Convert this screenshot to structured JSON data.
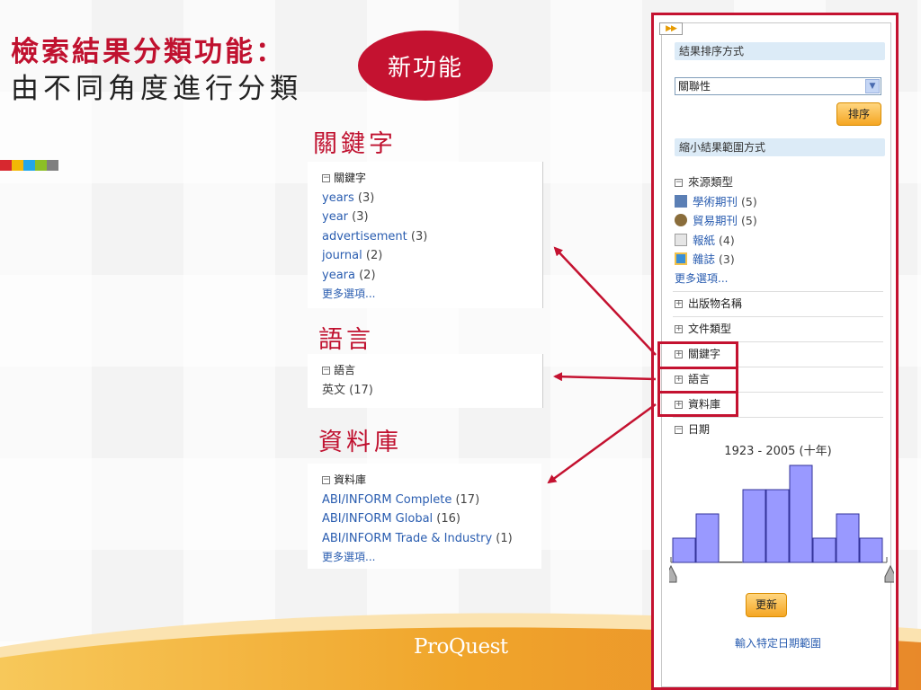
{
  "slide": {
    "title_line1": "檢索結果分類功能：",
    "title_line2": "由不同角度進行分類",
    "badge": "新功能",
    "strip_colors": [
      "#d7282f",
      "#f2b705",
      "#22a6e8",
      "#8cbf26",
      "#7f7f7f"
    ],
    "accent": "#c41230"
  },
  "sections": {
    "keyword": {
      "heading": "關鍵字",
      "facet_label": "關鍵字",
      "items": [
        {
          "term": "years",
          "count": "(3)"
        },
        {
          "term": "year",
          "count": "(3)"
        },
        {
          "term": "advertisement",
          "count": "(3)"
        },
        {
          "term": "journal",
          "count": "(2)"
        },
        {
          "term": "yeara",
          "count": "(2)"
        }
      ],
      "more": "更多選項..."
    },
    "language": {
      "heading": "語言",
      "facet_label": "語言",
      "items": [
        {
          "term": "英文",
          "count": "(17)"
        }
      ]
    },
    "database": {
      "heading": "資料庫",
      "facet_label": "資料庫",
      "items": [
        {
          "term": "ABI/INFORM Complete",
          "count": "(17)"
        },
        {
          "term": "ABI/INFORM Global",
          "count": "(16)"
        },
        {
          "term": "ABI/INFORM Trade & Industry",
          "count": "(1)"
        }
      ],
      "more": "更多選項..."
    }
  },
  "panel": {
    "sort_label": "結果排序方式",
    "sort_value": "關聯性",
    "sort_button": "排序",
    "narrow_label": "縮小結果範圍方式",
    "source_type": {
      "label": "來源類型",
      "items": [
        {
          "term": "學術期刊",
          "count": "(5)",
          "icon": "scholarly-journal-icon",
          "color": "#5b7fb5"
        },
        {
          "term": "貿易期刊",
          "count": "(5)",
          "icon": "trade-journal-icon",
          "color": "#8a6d3b"
        },
        {
          "term": "報紙",
          "count": "(4)",
          "icon": "newspaper-icon",
          "color": "#9e9e9e"
        },
        {
          "term": "雜誌",
          "count": "(3)",
          "icon": "magazine-icon",
          "color": "#3a8fd6"
        }
      ],
      "more": "更多選項..."
    },
    "facets": [
      "出版物名稱",
      "文件類型",
      "關鍵字",
      "語言",
      "資料庫"
    ],
    "date": {
      "label": "日期",
      "range": "1923 - 2005 (十年)",
      "update_button": "更新",
      "custom_link": "輸入特定日期範圍"
    }
  },
  "chart_data": {
    "type": "bar",
    "values": [
      1,
      2,
      0,
      3,
      3,
      4,
      1,
      2,
      1
    ],
    "ylim": [
      0,
      4
    ],
    "bar_color": "#9999ff"
  },
  "footer": {
    "logo": "ProQuest"
  }
}
